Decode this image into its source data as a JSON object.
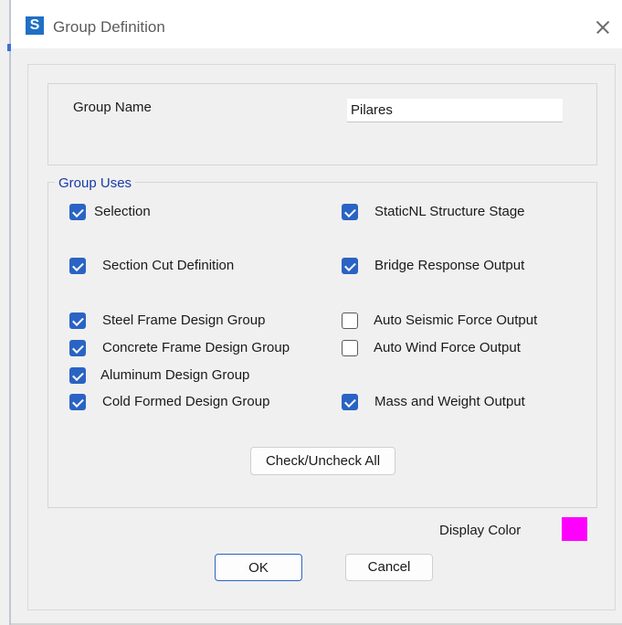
{
  "window": {
    "app_icon_letter": "S",
    "title": "Group Definition"
  },
  "group_name": {
    "label": "Group Name",
    "value": "Pilares"
  },
  "group_uses": {
    "legend": "Group Uses",
    "items": [
      {
        "label": "Selection",
        "checked": true
      },
      {
        "label": "StaticNL Structure Stage",
        "checked": true
      },
      {
        "label": "Section Cut Definition",
        "checked": true
      },
      {
        "label": "Bridge Response Output",
        "checked": true
      },
      {
        "label": "Steel Frame Design Group",
        "checked": true
      },
      {
        "label": "Auto Seismic Force Output",
        "checked": false
      },
      {
        "label": "Concrete Frame Design Group",
        "checked": true
      },
      {
        "label": "Auto Wind Force Output",
        "checked": false
      },
      {
        "label": "Aluminum Design Group",
        "checked": true
      },
      {
        "label": "Cold Formed Design Group",
        "checked": true
      },
      {
        "label": "Mass and Weight Output",
        "checked": true
      }
    ],
    "toggle_all_label": "Check/Uncheck All"
  },
  "display_color": {
    "label": "Display Color",
    "value": "#ff00ff"
  },
  "buttons": {
    "ok": "OK",
    "cancel": "Cancel"
  }
}
